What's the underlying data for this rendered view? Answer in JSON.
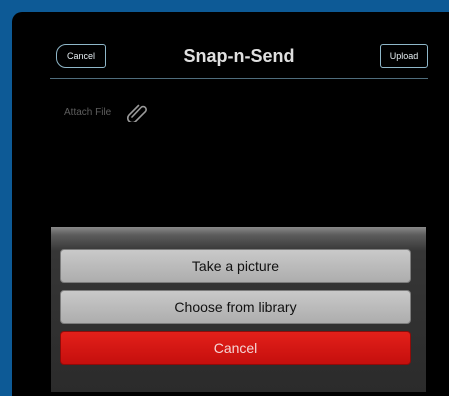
{
  "header": {
    "title": "Snap-n-Send",
    "cancel_label": "Cancel",
    "upload_label": "Upload"
  },
  "attach": {
    "label": "Attach File",
    "icon": "paperclip-icon"
  },
  "action_sheet": {
    "take_picture_label": "Take a picture",
    "choose_library_label": "Choose from library",
    "cancel_label": "Cancel"
  },
  "colors": {
    "background_frame": "#0d5a96",
    "screen": "#000000",
    "nav_border": "#8fb7c9",
    "sheet_button": "#bdbdbd",
    "cancel_red": "#d71814"
  }
}
